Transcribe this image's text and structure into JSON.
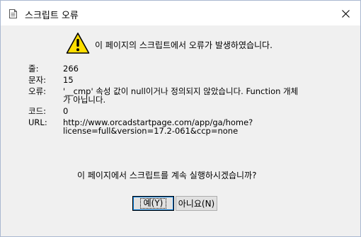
{
  "window": {
    "title": "스크립트 오류",
    "close_label": "✕"
  },
  "message": "이 페이지의 스크립트에서 오류가 발생하였습니다.",
  "fields": {
    "line": {
      "label": "줄:",
      "value": "266"
    },
    "char": {
      "label": "문자:",
      "value": "15"
    },
    "error": {
      "label": "오류:",
      "value_line1": "'__cmp' 속성 값이 null이거나 정의되지 않았습니다. Function 개체",
      "value_line2": "가 아닙니다."
    },
    "code": {
      "label": "코드:",
      "value": "0"
    },
    "url": {
      "label": "URL:",
      "value_line1": "http://www.orcadstartpage.com/app/ga/home?",
      "value_line2": "license=full&version=17.2-061&ccp=none"
    }
  },
  "question": "이 페이지에서 스크립트를 계속 실행하시겠습니까?",
  "buttons": {
    "yes_label": "예(Y)",
    "no_label": "아니요(N)"
  },
  "icons": {
    "title": "document-icon",
    "warning": "warning-icon",
    "close": "close-icon"
  },
  "colors": {
    "window_bg": "#f0f0f0",
    "titlebar_bg": "#ffffff",
    "warning_fill": "#ffde00",
    "focus_border": "#0078d7"
  }
}
